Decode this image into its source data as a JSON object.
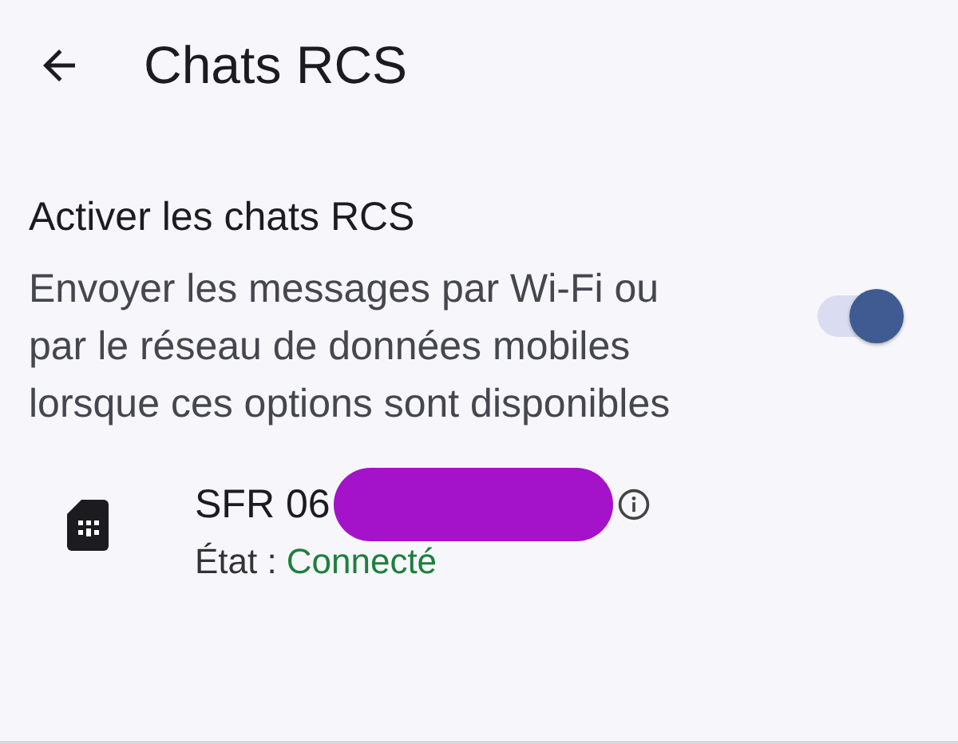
{
  "header": {
    "title": "Chats RCS"
  },
  "setting": {
    "title": "Activer les chats RCS",
    "description": "Envoyer les messages par Wi-Fi ou par le réseau de données mobiles lorsque ces options sont disponibles",
    "on": true
  },
  "sim": {
    "name": "SFR 06",
    "status_label": "État :",
    "status_value": "Connecté",
    "connected": true
  }
}
